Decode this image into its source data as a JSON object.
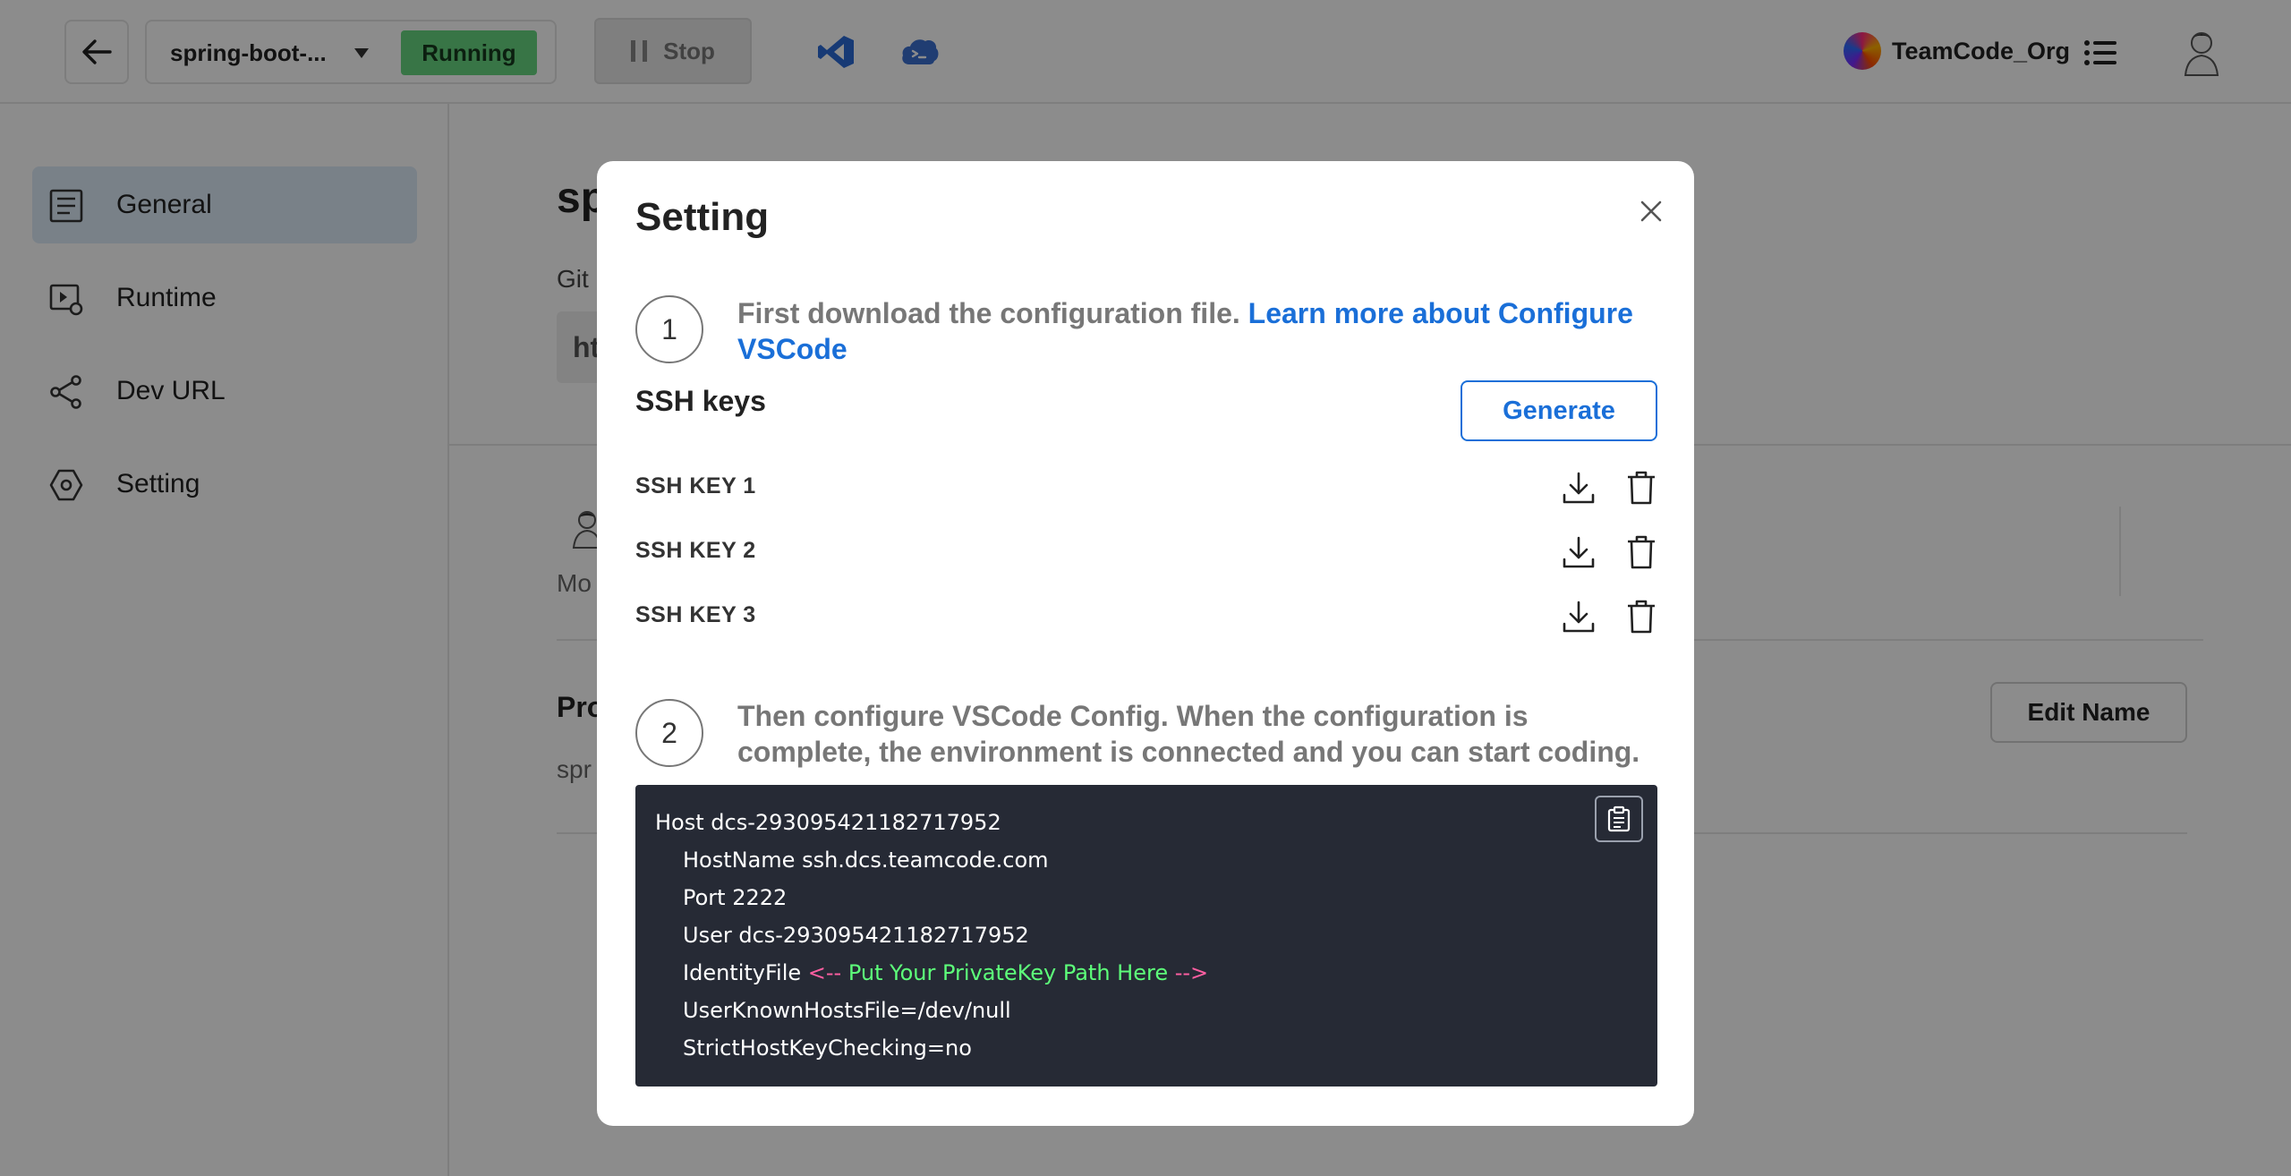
{
  "header": {
    "project_name": "spring-boot-...",
    "status": "Running",
    "stop_label": "Stop",
    "org_name": "TeamCode_Org"
  },
  "sidebar": {
    "items": [
      {
        "label": "General",
        "icon": "document-icon",
        "active": true
      },
      {
        "label": "Runtime",
        "icon": "runtime-icon",
        "active": false
      },
      {
        "label": "Dev URL",
        "icon": "share-icon",
        "active": false
      },
      {
        "label": "Setting",
        "icon": "hexagon-icon",
        "active": false
      }
    ]
  },
  "main": {
    "title": "sp",
    "git_label": "Git",
    "git_value": "ht",
    "member_label": "Mo",
    "section_title": "Pro",
    "section_sub": "spr",
    "edit_name_label": "Edit Name"
  },
  "modal": {
    "title": "Setting",
    "step1": {
      "number": "1",
      "text": "First download the configuration file. ",
      "link": "Learn more about Configure VSCode"
    },
    "ssh_title": "SSH keys",
    "generate_label": "Generate",
    "keys": [
      {
        "name": "SSH KEY 1"
      },
      {
        "name": "SSH KEY 2"
      },
      {
        "name": "SSH KEY 3"
      }
    ],
    "step2": {
      "number": "2",
      "text": "Then configure VSCode Config. When the configuration is complete, the environment is connected and you can start coding."
    },
    "config": {
      "host": "Host dcs-293095421182717952",
      "hostname": "HostName ssh.dcs.teamcode.com",
      "port": "Port 2222",
      "user": "User dcs-293095421182717952",
      "identity_prefix": "IdentityFile ",
      "identity_open": "<-- ",
      "identity_body": "Put Your PrivateKey Path Here",
      "identity_close": " -->",
      "known_hosts": "UserKnownHostsFile=/dev/null",
      "strict": "StrictHostKeyChecking=no"
    }
  },
  "colors": {
    "accent": "#1a6fd8",
    "running": "#67d680",
    "code_bg": "#262a35",
    "comment_marker": "#ff5fa2",
    "comment_text": "#5dff7a"
  }
}
